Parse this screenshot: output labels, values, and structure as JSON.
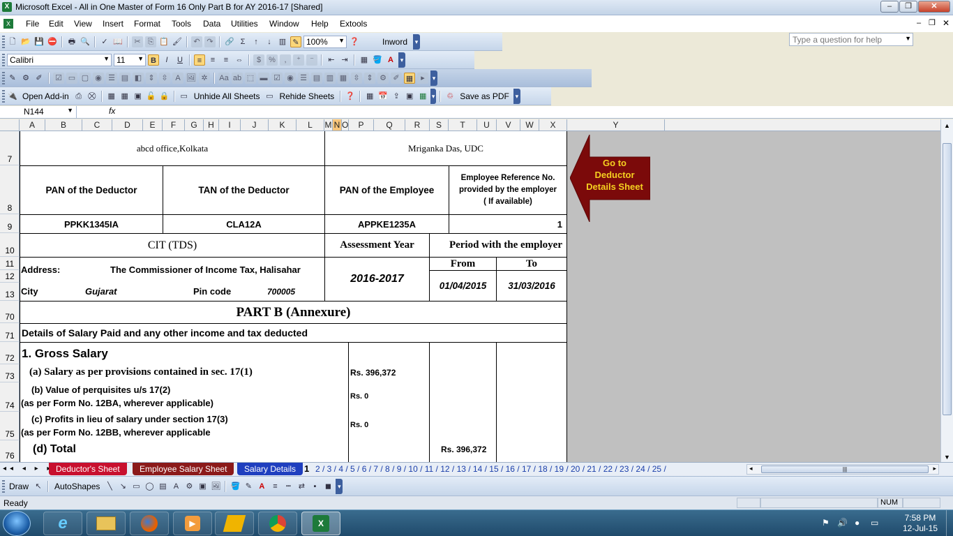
{
  "window": {
    "title": "Microsoft Excel - All in One Master of Form 16 Only Part  B for AY 2016-17  [Shared]",
    "app_icon": "X"
  },
  "menu": [
    "File",
    "Edit",
    "View",
    "Insert",
    "Format",
    "Tools",
    "Data",
    "Utilities",
    "Window",
    "Help",
    "Extools"
  ],
  "help": {
    "placeholder": "Type a question for help"
  },
  "toolbar1": {
    "zoom": "100%",
    "inword": "Inword"
  },
  "toolbar2": {
    "font": "Calibri",
    "size": "11",
    "bold": "B",
    "italic": "I",
    "underline": "U",
    "currency": "$",
    "percent": "%",
    "comma": ","
  },
  "toolbar4": {
    "open_addin": "Open Add-in",
    "unhide": "Unhide All Sheets",
    "rehide": "Rehide Sheets",
    "save_pdf": "Save as PDF"
  },
  "formula": {
    "cell_ref": "N144",
    "fx": "fx",
    "content": ""
  },
  "columns": [
    "A",
    "B",
    "C",
    "D",
    "E",
    "F",
    "G",
    "H",
    "I",
    "J",
    "K",
    "L",
    "M",
    "N",
    "O",
    "P",
    "Q",
    "R",
    "S",
    "T",
    "U",
    "V",
    "W",
    "X",
    "Y"
  ],
  "rows": [
    "7",
    "8",
    "9",
    "10",
    "11",
    "12",
    "13",
    "70",
    "71",
    "72",
    "73",
    "74",
    "75",
    "76"
  ],
  "form": {
    "office": "abcd office,Kolkata",
    "employee_name": "Mriganka Das, UDC",
    "pan_deductor_label": "PAN of the Deductor",
    "tan_deductor_label": "TAN of the Deductor",
    "pan_employee_label": "PAN of the Employee",
    "emp_ref_label_1": "Employee Reference No.",
    "emp_ref_label_2": "provided by the employer",
    "emp_ref_label_3": "( If available)",
    "pan_deductor": "PPKK1345IA",
    "tan_deductor": "CLA12A",
    "pan_employee": "APPKE1235A",
    "emp_ref": "1",
    "cit_label": "CIT (TDS)",
    "assessment_year_label": "Assessment Year",
    "period_label": "Period with the employer",
    "from_label": "From",
    "to_label": "To",
    "address_label": "Address:",
    "address": "The Commissioner of Income Tax, Halisahar",
    "city_label": "City",
    "city": "Gujarat",
    "pin_label": "Pin code",
    "pin": "700005",
    "assessment_year": "2016-2017",
    "from_date": "01/04/2015",
    "to_date": "31/03/2016",
    "part_b": "PART B (Annexure)",
    "details_heading": "Details of Salary Paid and any other income and tax deducted",
    "gross_salary": "1.  Gross Salary",
    "line_a": "(a) Salary as per provisions contained in sec. 17(1)",
    "line_a_val": "Rs. 396,372",
    "line_b1": "(b) Value of perquisites u/s 17(2)",
    "line_b2": "(as per Form No. 12BA, wherever applicable)",
    "line_b_val": "Rs. 0",
    "line_c1": "(c) Profits in lieu of salary under section 17(3)",
    "line_c2": "(as per Form No. 12BB, wherever applicable",
    "line_c_val": "Rs. 0",
    "line_d": "(d) Total",
    "line_d_val": "Rs. 396,372"
  },
  "arrow_button": {
    "line1": "Go to",
    "line2": "Deductor",
    "line3": "Details   Sheet",
    "color": "#7b0a0a",
    "text_color": "#f5d020"
  },
  "sheet_tabs": [
    {
      "label": "Deductor's Sheet",
      "color": "#c8102e"
    },
    {
      "label": "Employee Salary Sheet",
      "color": "#8b1a1a"
    },
    {
      "label": "Salary Details",
      "color": "#1f3fbf"
    }
  ],
  "active_tab": "1",
  "numbered_tabs": "2 / 3 / 4 / 5 / 6 / 7 / 8 / 9 / 10 / 11 / 12 / 13 / 14 / 15 / 16 / 17 / 18 / 19 / 20 / 21 / 22 / 23 / 24 / 25 /",
  "drawbar": {
    "draw": "Draw",
    "autoshapes": "AutoShapes"
  },
  "status": {
    "text": "Ready",
    "num": "NUM"
  },
  "clock": {
    "time": "7:58 PM",
    "date": "12-Jul-15"
  }
}
